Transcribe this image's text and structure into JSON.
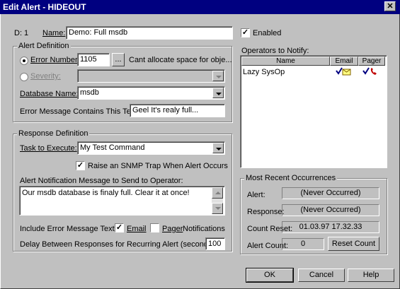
{
  "window": {
    "title": "Edit Alert - HIDEOUT",
    "close": "✕"
  },
  "general": {
    "id_text": "D: 1",
    "name_label": "Name:",
    "name_value": "Demo: Full msdb",
    "enabled_label": "Enabled",
    "enabled_checked": true
  },
  "alert_def": {
    "group_label": "Alert Definition",
    "error_number_label": "Error Number:",
    "error_number_value": "1105",
    "browse_label": "...",
    "error_desc": "Cant allocate space for obje...",
    "severity_label": "Severity:",
    "database_label": "Database Name:",
    "database_value": "msdb",
    "contains_label": "Error Message Contains This Text:",
    "contains_value": "Geel It's realy full..."
  },
  "operators": {
    "label": "Operators to Notify:",
    "columns": [
      "Name",
      "Email",
      "Pager"
    ],
    "rows": [
      {
        "name": "Lazy SysOp",
        "email_icon": "mail-check-icon",
        "pager_icon": "pager-check-icon"
      }
    ]
  },
  "response_def": {
    "group_label": "Response Definition",
    "task_label": "Task to Execute:",
    "task_value": "My Test Command",
    "snmp_label": "Raise an SNMP Trap When Alert Occurs",
    "snmp_checked": true,
    "notif_label": "Alert Notification Message to Send to Operator:",
    "notif_value": "Our msdb database is finaly full. Clear it at once!",
    "include_label": "Include Error Message Text in",
    "email_label": "Email",
    "email_checked": true,
    "pager_label": "Pager",
    "pager_checked": false,
    "notifications_label": "Notifications",
    "delay_label": "Delay Between Responses for Recurring Alert (seconds):",
    "delay_value": "100"
  },
  "recent": {
    "group_label": "Most Recent Occurrences",
    "alert_label": "Alert:",
    "alert_value": "(Never Occurred)",
    "response_label": "Response:",
    "response_value": "(Never Occurred)",
    "count_reset_label": "Count Reset:",
    "count_reset_value": "01.03.97 17.32.33",
    "alert_count_label": "Alert Count:",
    "alert_count_value": "0",
    "reset_button": "Reset Count"
  },
  "buttons": {
    "ok": "OK",
    "cancel": "Cancel",
    "help": "Help"
  }
}
